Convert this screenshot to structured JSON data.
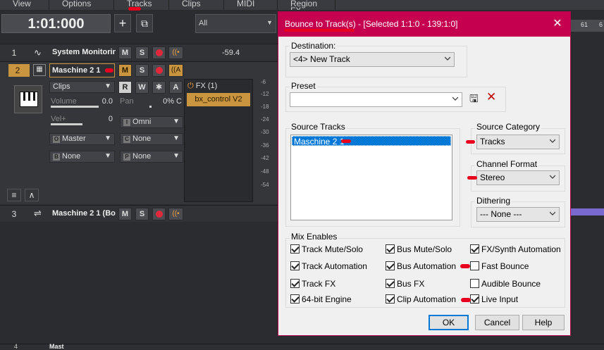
{
  "menu": [
    "View",
    "Options",
    "Tracks",
    "Clips",
    "MIDI",
    "Region FX"
  ],
  "transport": {
    "time": "1:01:000",
    "add_label": "+",
    "filter_value": "All"
  },
  "ruler": {
    "ticks": [
      "61",
      "6"
    ]
  },
  "tracks": [
    {
      "num": "1",
      "name": "System Monitorin",
      "level": "-59.4",
      "m": "M",
      "s": "S"
    },
    {
      "num": "2",
      "name": "Maschine 2 1",
      "m": "M",
      "s": "S",
      "mon_sub": "A",
      "clips": "Clips",
      "r": "R",
      "w": "W",
      "star": "✱",
      "a": "A",
      "volume_label": "Volume",
      "volume_value": "0.0",
      "pan_label": "Pan",
      "pan_value": "0% C",
      "vel_label": "Vel+",
      "vel_value": "0",
      "input": "Omni",
      "output": "Master",
      "aux1": "None",
      "aux2": "None",
      "aux3": "None",
      "input_tag": "I",
      "output_tag": "O",
      "c_tag": "C",
      "b_tag": "B",
      "p_tag": "P",
      "fx_label": "FX (1)",
      "plugin": "bx_control V2"
    },
    {
      "num": "3",
      "name": "Maschine 2 1 (Bo",
      "m": "M",
      "s": "S"
    }
  ],
  "meter_scale": [
    "-6",
    "-12",
    "-18",
    "-24",
    "-30",
    "-36",
    "-42",
    "-48",
    "-54"
  ],
  "bottom_track": {
    "num": "4",
    "name": "Mast"
  },
  "dialog": {
    "title": "Bounce to Track(s) - [Selected 1:1:0 - 139:1:0]",
    "destination_label": "Destination:",
    "destination_value": "<4> New Track",
    "preset_label": "Preset",
    "preset_value": "",
    "source_tracks_label": "Source Tracks",
    "source_tracks": [
      "Maschine 2 1"
    ],
    "source_category_label": "Source Category",
    "source_category_value": "Tracks",
    "channel_format_label": "Channel Format",
    "channel_format_value": "Stereo",
    "dithering_label": "Dithering",
    "dithering_value": "--- None ---",
    "mix_enables_label": "Mix Enables",
    "options": [
      {
        "label": "Track Mute/Solo",
        "checked": true
      },
      {
        "label": "Bus Mute/Solo",
        "checked": true
      },
      {
        "label": "FX/Synth Automation",
        "checked": true
      },
      {
        "label": "Track Automation",
        "checked": true
      },
      {
        "label": "Bus Automation",
        "checked": true
      },
      {
        "label": "Fast Bounce",
        "checked": false
      },
      {
        "label": "Track FX",
        "checked": true
      },
      {
        "label": "Bus FX",
        "checked": true
      },
      {
        "label": "Audible Bounce",
        "checked": false
      },
      {
        "label": "64-bit Engine",
        "checked": true
      },
      {
        "label": "Clip Automation",
        "checked": true
      },
      {
        "label": "Live Input",
        "checked": true
      }
    ],
    "ok_label": "OK",
    "cancel_label": "Cancel",
    "help_label": "Help"
  },
  "colors": {
    "title_bar": "#c4004f",
    "accent_orange": "#c9953f",
    "annotation_red": "#e8001e"
  }
}
